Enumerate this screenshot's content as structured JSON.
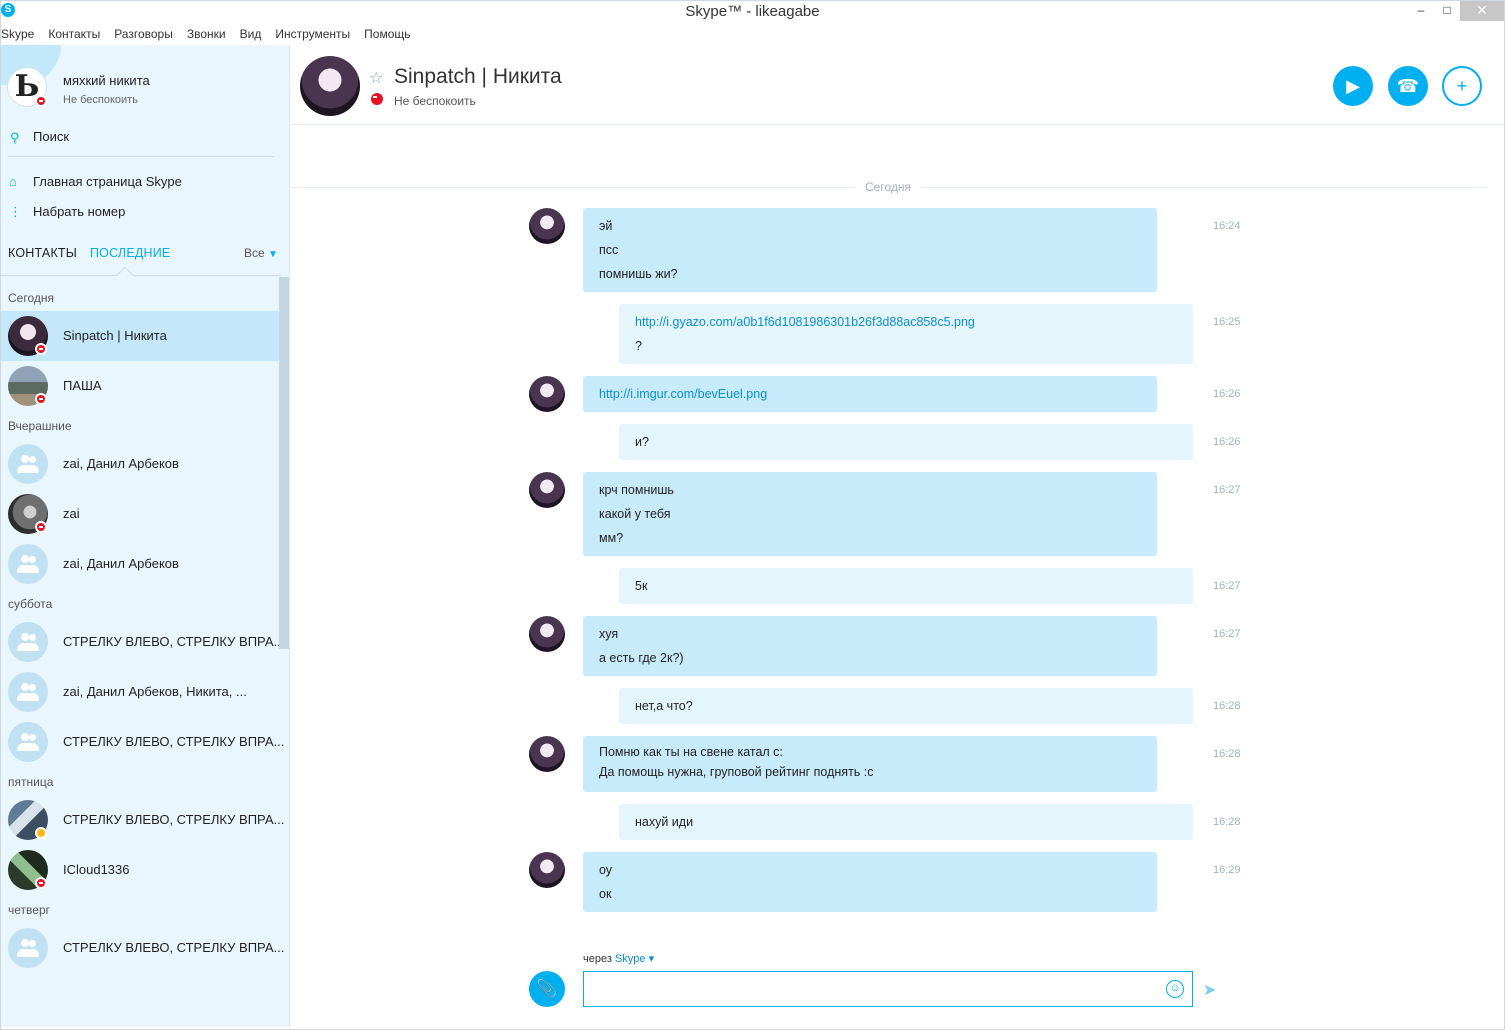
{
  "window": {
    "title": "Skype™ - likeagabe",
    "minimize": "–",
    "maximize": "□",
    "close": "✕"
  },
  "menu": [
    "Skype",
    "Контакты",
    "Разговоры",
    "Звонки",
    "Вид",
    "Инструменты",
    "Помощь"
  ],
  "profile": {
    "avatar_letter": "Ь",
    "name": "мяхкий никита",
    "status": "Не беспокоить"
  },
  "search": {
    "label": "Поиск"
  },
  "nav": {
    "home": "Главная страница Skype",
    "dial": "Набрать номер"
  },
  "tabs": {
    "contacts": "КОНТАКТЫ",
    "recent": "ПОСЛЕДНИЕ",
    "filter": "Все"
  },
  "recent": [
    {
      "group": "Сегодня"
    },
    {
      "name": "Sinpatch | Никита",
      "avatar": "photo1",
      "status": "dnd",
      "selected": true
    },
    {
      "name": "ПАША",
      "avatar": "photo2",
      "status": "dnd"
    },
    {
      "group": "Вчерашние"
    },
    {
      "name": "zai, Данил Арбеков",
      "avatar": "group"
    },
    {
      "name": "zai",
      "avatar": "photo3",
      "status": "dnd"
    },
    {
      "name": "zai, Данил Арбеков",
      "avatar": "group"
    },
    {
      "group": "суббота"
    },
    {
      "name": "СТРЕЛКУ ВЛЕВО, СТРЕЛКУ ВПРА...",
      "avatar": "group"
    },
    {
      "name": "zai, Данил Арбеков, Никита, ...",
      "avatar": "group"
    },
    {
      "name": "СТРЕЛКУ ВЛЕВО, СТРЕЛКУ ВПРА...",
      "avatar": "group"
    },
    {
      "group": "пятница"
    },
    {
      "name": "СТРЕЛКУ ВЛЕВО, СТРЕЛКУ ВПРА...",
      "avatar": "photo4",
      "status": "away"
    },
    {
      "name": "ICloud1336",
      "avatar": "photo5",
      "status": "dnd"
    },
    {
      "group": "четверг"
    },
    {
      "name": "СТРЕЛКУ ВЛЕВО, СТРЕЛКУ ВПРА...",
      "avatar": "group"
    }
  ],
  "conversation": {
    "name": "Sinpatch | Никита",
    "status": "Не беспокоить",
    "day": "Сегодня",
    "messages": [
      {
        "dir": "in",
        "lines": [
          "эй",
          "псс",
          "помнишь жи?"
        ],
        "time": "16:24"
      },
      {
        "dir": "out",
        "lines": [
          "http://i.gyazo.com/a0b1f6d1081986301b26f3d88ac858c5.png",
          "?"
        ],
        "link": 0,
        "time": "16:25"
      },
      {
        "dir": "in",
        "lines": [
          "http://i.imgur.com/bevEuel.png"
        ],
        "link": 0,
        "time": "16:26"
      },
      {
        "dir": "out",
        "lines": [
          "и?"
        ],
        "time": "16:26"
      },
      {
        "dir": "in",
        "lines": [
          "крч помнишь",
          "какой у тебя",
          "мм?"
        ],
        "time": "16:27"
      },
      {
        "dir": "out",
        "lines": [
          "5к"
        ],
        "time": "16:27"
      },
      {
        "dir": "in",
        "lines": [
          "хуя",
          "а есть где 2к?)"
        ],
        "time": "16:27"
      },
      {
        "dir": "out",
        "lines": [
          "нет,а что?"
        ],
        "time": "16:28"
      },
      {
        "dir": "in",
        "lines": [
          "Помню как ты на свене катал с:",
          "Да помощь нужна, груповой рейтинг поднять :с"
        ],
        "time": "16:28"
      },
      {
        "dir": "out",
        "lines": [
          "нахуй иди"
        ],
        "time": "16:28"
      },
      {
        "dir": "in",
        "lines": [
          "оу",
          "ок"
        ],
        "time": "16:29"
      }
    ]
  },
  "composer": {
    "via_prefix": "через",
    "via_service": "Skype",
    "value": "",
    "placeholder": ""
  },
  "colors": {
    "accent": "#00aff0",
    "incoming": "#c7ebfa",
    "outgoing": "#e4f5fc",
    "dnd": "#e81123",
    "away": "#fdb813"
  }
}
